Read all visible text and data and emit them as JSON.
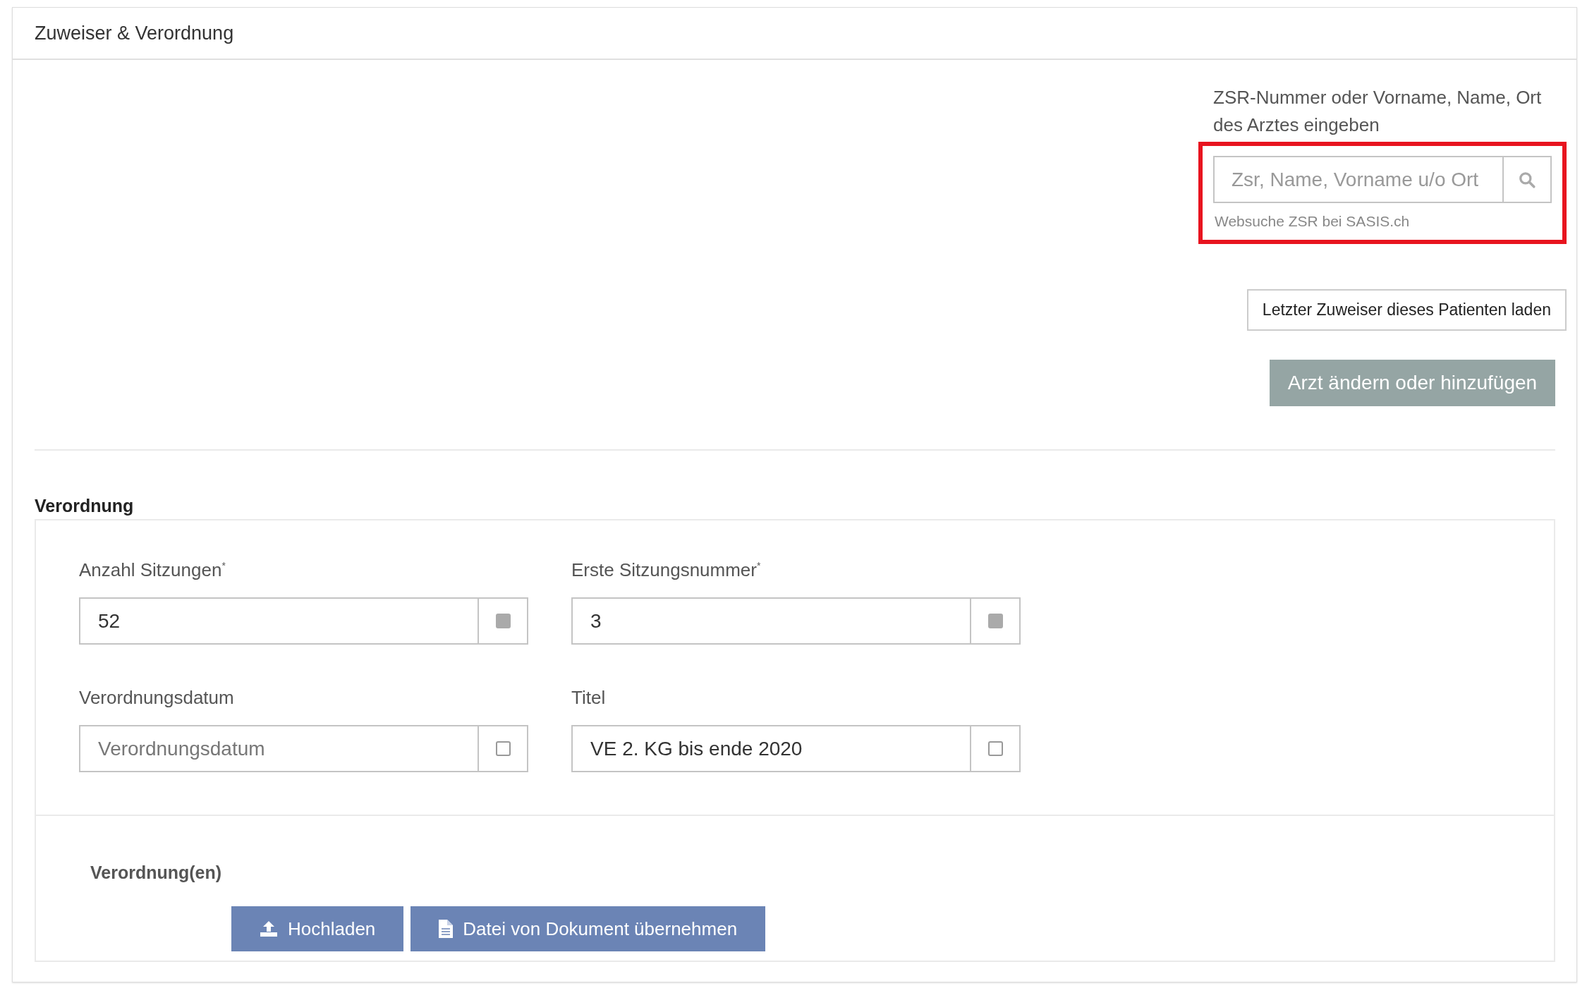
{
  "panel": {
    "title": "Zuweiser & Verordnung"
  },
  "doctor_search": {
    "label": "ZSR-Nummer oder Vorname, Name, Ort des Arztes eingeben",
    "highlighted": true,
    "field": {
      "placeholder": "Zsr, Name, Vorname u/o Ort"
    },
    "hint_link": "Websuche ZSR bei SASIS.ch"
  },
  "buttons": [
    {
      "label": "Letzter Zuweiser dieses Patienten laden",
      "kind": "outline"
    },
    {
      "label": "Arzt ändern oder hinzufügen",
      "kind": "filled"
    }
  ],
  "prescription": {
    "heading": "Verordnung",
    "fields": [
      {
        "label": "Anzahl Sitzungen$^{*}$",
        "value": "52",
        "checked": true
      },
      {
        "label": "Erste Sitzungsnummer$^{*}$",
        "value": "3",
        "checked": true
      },
      {
        "label": "Verordnungsdatum",
        "placeholder": "Verordnungsdatum",
        "checked": false
      },
      {
        "label": "Titel",
        "value": "VE 2. KG bis ende 2020",
        "checked": false
      }
    ],
    "documents": {
      "heading": "Verordnung(en)",
      "buttons": [
        {
          "label": "Hochladen",
          "kind": "upload"
        },
        {
          "label": "Datei von Dokument übernehmen",
          "kind": "file"
        }
      ]
    }
  }
}
